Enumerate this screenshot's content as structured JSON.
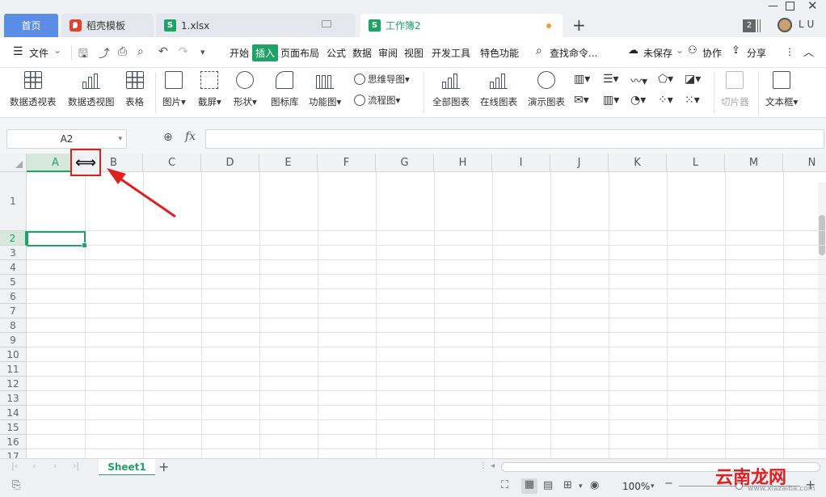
{
  "tabs": {
    "home": "首页",
    "docer": "稻壳模板",
    "file1": "1.xlsx",
    "active": "工作簿2",
    "add": "+"
  },
  "titlebar": {
    "badge": "2",
    "user": "L U",
    "accent": "#5b8de6"
  },
  "menu": {
    "file": "文件",
    "items": [
      "开始",
      "插入",
      "页面布局",
      "公式",
      "数据",
      "审阅",
      "视图",
      "开发工具",
      "特色功能"
    ],
    "active_index": 1,
    "search": "查找命令...",
    "unsaved": "未保存",
    "collab": "协作",
    "share": "分享",
    "accent": "#1fa266"
  },
  "ribbon": {
    "pivot_table": "数据透视表",
    "pivot_chart": "数据透视图",
    "table": "表格",
    "picture": "图片",
    "screenshot": "截屏",
    "shapes": "形状",
    "icons": "图标库",
    "function_chart": "功能图",
    "mindmap": "思维导图",
    "flowchart": "流程图",
    "all_charts": "全部图表",
    "online_charts": "在线图表",
    "demo_charts": "演示图表",
    "slicer": "切片器",
    "textbox": "文本框"
  },
  "formula": {
    "name_box": "A2",
    "fx": "fx",
    "value": ""
  },
  "grid": {
    "columns": [
      "A",
      "B",
      "C",
      "D",
      "E",
      "F",
      "G",
      "H",
      "I",
      "J",
      "K",
      "L",
      "M",
      "N"
    ],
    "rows": [
      "1",
      "2",
      "3",
      "4",
      "5",
      "6",
      "7",
      "8",
      "9",
      "10",
      "11",
      "12",
      "13",
      "14",
      "15",
      "16",
      "17"
    ],
    "selected_cell": "A2",
    "resize_cursor": "⟺"
  },
  "sheets": {
    "names": [
      "Sheet1"
    ],
    "active": "Sheet1"
  },
  "status": {
    "zoom": "100%"
  },
  "watermark": {
    "text": "云南龙网",
    "sub": "www.xiazaiba.com"
  }
}
